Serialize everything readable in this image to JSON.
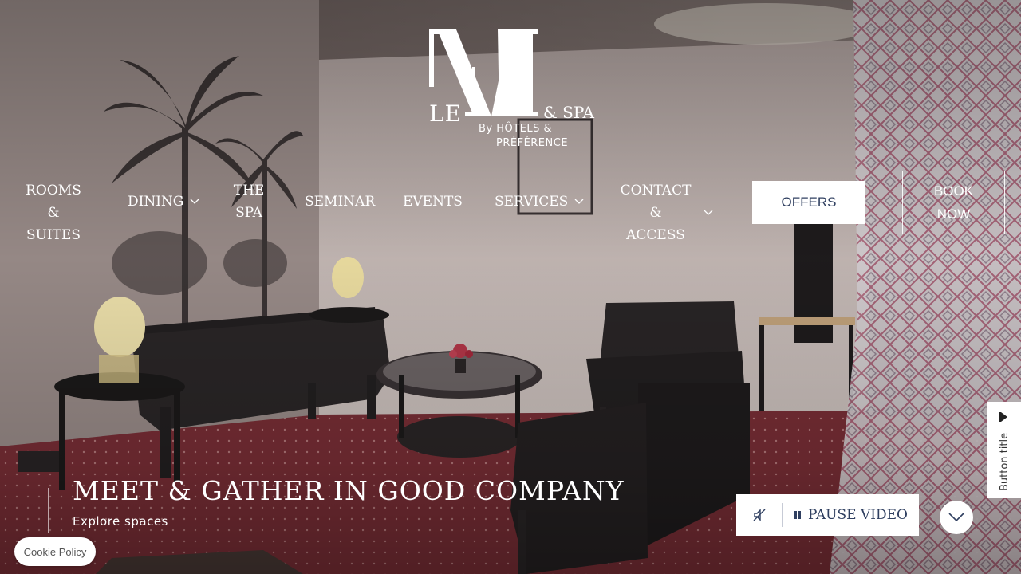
{
  "logo": {
    "le": "LE",
    "spa": "& SPA",
    "by_line": "By HÔTELS &",
    "by_line_2": "PRÉFÉRENCE"
  },
  "nav": {
    "rooms": "ROOMS &\nSUITES",
    "dining": "DINING",
    "spa": "THE\nSPA",
    "seminar": "SEMINAR",
    "events": "EVENTS",
    "services": "SERVICES",
    "contact": "CONTACT &\nACCESS",
    "offers": "OFFERS",
    "book": "BOOK\nNOW"
  },
  "hero": {
    "headline": "MEET & GATHER IN GOOD COMPANY",
    "explore": "Explore spaces"
  },
  "video": {
    "pause_label": "PAUSE VIDEO"
  },
  "side_tab": {
    "label": "Button title"
  },
  "cookie": {
    "label": "Cookie Policy"
  },
  "colors": {
    "navy": "#2f3f60",
    "white": "#ffffff",
    "carpet": "#7a2d35"
  },
  "icons": {
    "mute": "sound-off-icon",
    "pause": "pause-icon",
    "scroll": "chevron-down-icon",
    "side": "arrow-icon"
  }
}
